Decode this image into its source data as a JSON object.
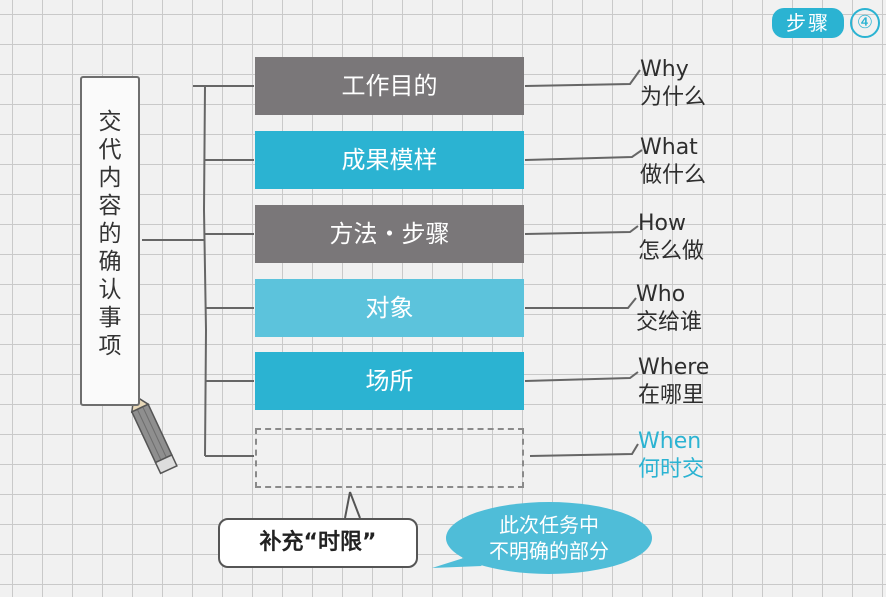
{
  "step": {
    "label": "步骤",
    "number": "④"
  },
  "vertical_label": "交代内容的确认事项",
  "items": [
    {
      "box": "工作目的",
      "en": "Why",
      "cn": "为什么"
    },
    {
      "box": "成果模样",
      "en": "What",
      "cn": "做什么"
    },
    {
      "box": "方法・步骤",
      "en": "How",
      "cn": "怎么做"
    },
    {
      "box": "对象",
      "en": "Who",
      "cn": "交给谁"
    },
    {
      "box": "场所",
      "en": "Where",
      "cn": "在哪里"
    },
    {
      "box": "",
      "en": "When",
      "cn": "何时交"
    }
  ],
  "callout": "补充“时限”",
  "bubble": {
    "line1": "此次任务中",
    "line2": "不明确的部分"
  },
  "colors": {
    "gray": "#7a7779",
    "blue": "#2bb3d2",
    "light_blue": "#5cc3dc"
  }
}
